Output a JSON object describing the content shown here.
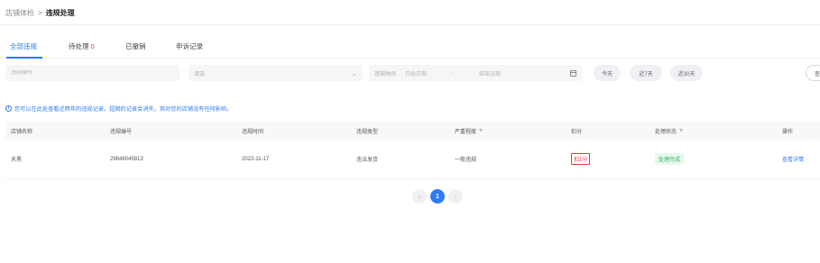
{
  "breadcrumb": {
    "root": "店铺体检",
    "separator": ">",
    "current": "违规处理"
  },
  "tabs": [
    {
      "label": "全部违规",
      "count": ""
    },
    {
      "label": "待处理",
      "count": "0"
    },
    {
      "label": "已撤销",
      "count": ""
    },
    {
      "label": "申诉记录",
      "count": ""
    }
  ],
  "active_tab": 0,
  "filters": {
    "violation_no_placeholder": "违规编号",
    "select_placeholder": "请选",
    "date_label": "违规时间",
    "date_start_placeholder": "开始日期",
    "date_separator": "-",
    "date_end_placeholder": "结束日期",
    "quick_today": "今天",
    "quick_7days": "近7天",
    "quick_30days": "近30天",
    "right_button": "查"
  },
  "notice": {
    "icon": "i",
    "text": "您可以在此处查看近两年的违规记录。超期的记录会消失，但对您的店铺没有任何影响。"
  },
  "table": {
    "headers": [
      "店铺名称",
      "违规编号",
      "违规时间",
      "违规类型",
      "严重程度",
      "扣分",
      "处理状态",
      "操作"
    ],
    "rows": [
      {
        "shop": "天黑",
        "violation_no": "29848045813",
        "time": "2022-11-17",
        "type": "违法发货",
        "severity": "一般违规",
        "deduct": "扣1分",
        "status": "处理完成",
        "action": "查看详情"
      }
    ]
  },
  "pagination": {
    "prev": "‹",
    "current": "1",
    "next": "›"
  },
  "colors": {
    "accent": "#2f7cf6",
    "danger": "#e53935",
    "success": "#2bb55a"
  }
}
